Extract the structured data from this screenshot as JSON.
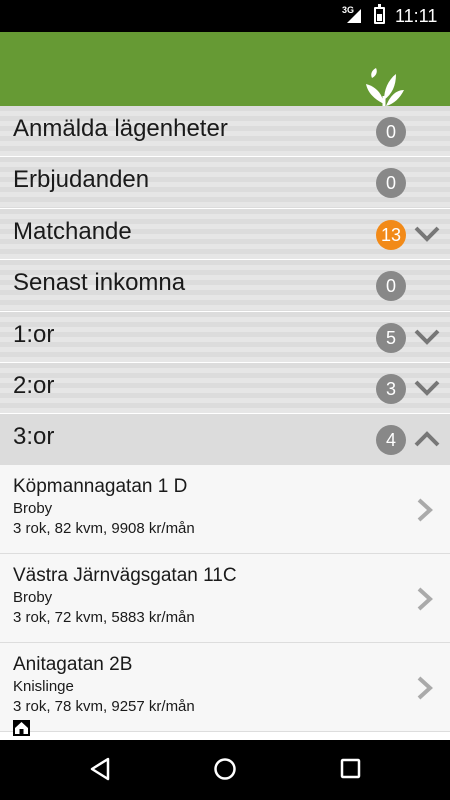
{
  "status_bar": {
    "network": "3G",
    "time": "11:11"
  },
  "app_bar": {
    "logo_icon": "tree-house-logo-icon",
    "color": "#669a34"
  },
  "menu": [
    {
      "label": "Anmälda lägenheter",
      "count": "0",
      "highlight": false,
      "chevron": "none"
    },
    {
      "label": "Erbjudanden",
      "count": "0",
      "highlight": false,
      "chevron": "none"
    },
    {
      "label": "Matchande",
      "count": "13",
      "highlight": true,
      "chevron": "down"
    },
    {
      "label": "Senast inkomna",
      "count": "0",
      "highlight": false,
      "chevron": "none"
    },
    {
      "label": "1:or",
      "count": "5",
      "highlight": false,
      "chevron": "down"
    },
    {
      "label": "2:or",
      "count": "3",
      "highlight": false,
      "chevron": "down"
    },
    {
      "label": "3:or",
      "count": "4",
      "highlight": false,
      "chevron": "up"
    }
  ],
  "listings": [
    {
      "address": "Köpmannagatan 1 D",
      "area": "Broby",
      "info": "3 rok, 82 kvm, 9908 kr/mån"
    },
    {
      "address": "Västra Järnvägsgatan 11C",
      "area": "Broby",
      "info": "3 rok, 72 kvm, 5883 kr/mån"
    },
    {
      "address": "Anitagatan 2B",
      "area": "Knislinge",
      "info": "3 rok, 78 kvm, 9257 kr/mån"
    }
  ],
  "colors": {
    "accent": "#669a34",
    "badge_default": "#888888",
    "badge_highlight": "#f28a18"
  },
  "nav_bar": {
    "icons": [
      "back-icon",
      "home-icon",
      "recents-icon"
    ]
  }
}
